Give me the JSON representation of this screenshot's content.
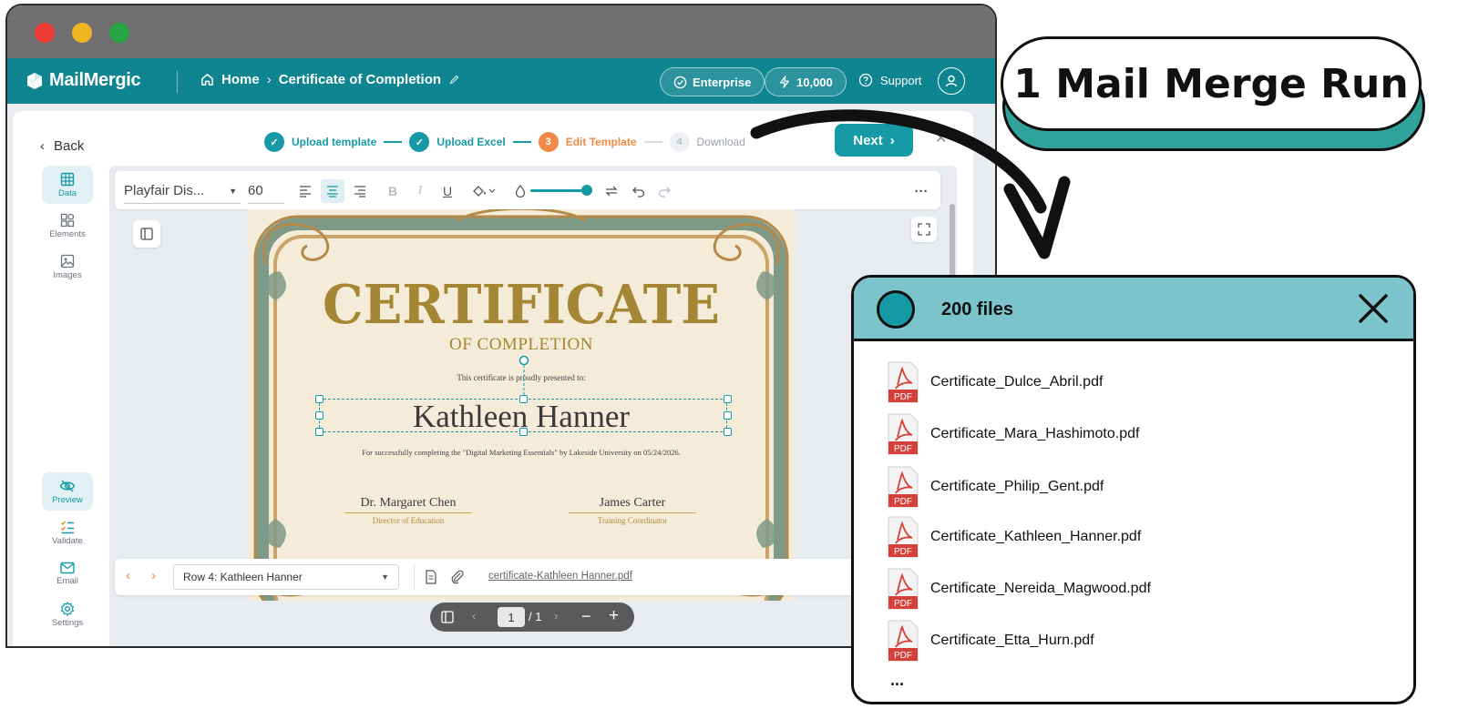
{
  "app": {
    "brand": "MailMergic",
    "breadcrumb": {
      "home": "Home",
      "separator": "›",
      "current": "Certificate of Completion"
    },
    "plan": "Enterprise",
    "credits": "10,000",
    "support": "Support"
  },
  "header": {
    "back": "Back",
    "steps": [
      {
        "num": "1",
        "label": "Upload template",
        "state": "done"
      },
      {
        "num": "2",
        "label": "Upload Excel",
        "state": "done"
      },
      {
        "num": "3",
        "label": "Edit Template",
        "state": "current"
      },
      {
        "num": "4",
        "label": "Download",
        "state": "todo"
      }
    ],
    "next": "Next"
  },
  "rail": {
    "top": [
      {
        "label": "Data",
        "icon": "table-icon",
        "active": true
      },
      {
        "label": "Elements",
        "icon": "elements-icon",
        "active": false
      },
      {
        "label": "Images",
        "icon": "image-icon",
        "active": false
      }
    ],
    "bottom": [
      {
        "label": "Preview",
        "icon": "eye-off-icon",
        "active": true
      },
      {
        "label": "Validate",
        "icon": "checklist-icon",
        "active": false
      },
      {
        "label": "Email",
        "icon": "mail-icon",
        "active": false
      },
      {
        "label": "Settings",
        "icon": "gear-icon",
        "active": false
      }
    ]
  },
  "toolbar": {
    "font": "Playfair Dis...",
    "size": "60",
    "more": "···"
  },
  "certificate": {
    "title": "CERTIFICATE",
    "subtitle": "OF COMPLETION",
    "presented": "This certificate is proudly presented to:",
    "name": "Kathleen Hanner",
    "description": "For successfully completing the \"Digital Marketing Essentials\" by Lakeside University on 05/24/2026.",
    "signer1": {
      "name": "Dr. Margaret Chen",
      "role": "Director of Education"
    },
    "signer2": {
      "name": "James Carter",
      "role": "Training Coordinator"
    }
  },
  "rowbar": {
    "row": "Row 4: Kathleen Hanner",
    "file": "certificate-Kathleen Hanner.pdf"
  },
  "pager": {
    "page": "1",
    "total": "/ 1"
  },
  "callout": {
    "run": "1 Mail Merge Run"
  },
  "files_panel": {
    "title": "200 files",
    "files": [
      "Certificate_Dulce_Abril.pdf",
      "Certificate_Mara_Hashimoto.pdf",
      "Certificate_Philip_Gent.pdf",
      "Certificate_Kathleen_Hanner.pdf",
      "Certificate_Nereida_Magwood.pdf",
      "Certificate_Etta_Hurn.pdf"
    ],
    "more": "...",
    "pdf_badge": "PDF"
  },
  "colors": {
    "accent": "#159aa6",
    "appbar": "#0e8591",
    "step_current": "#f08a46",
    "gold": "#a58634"
  }
}
